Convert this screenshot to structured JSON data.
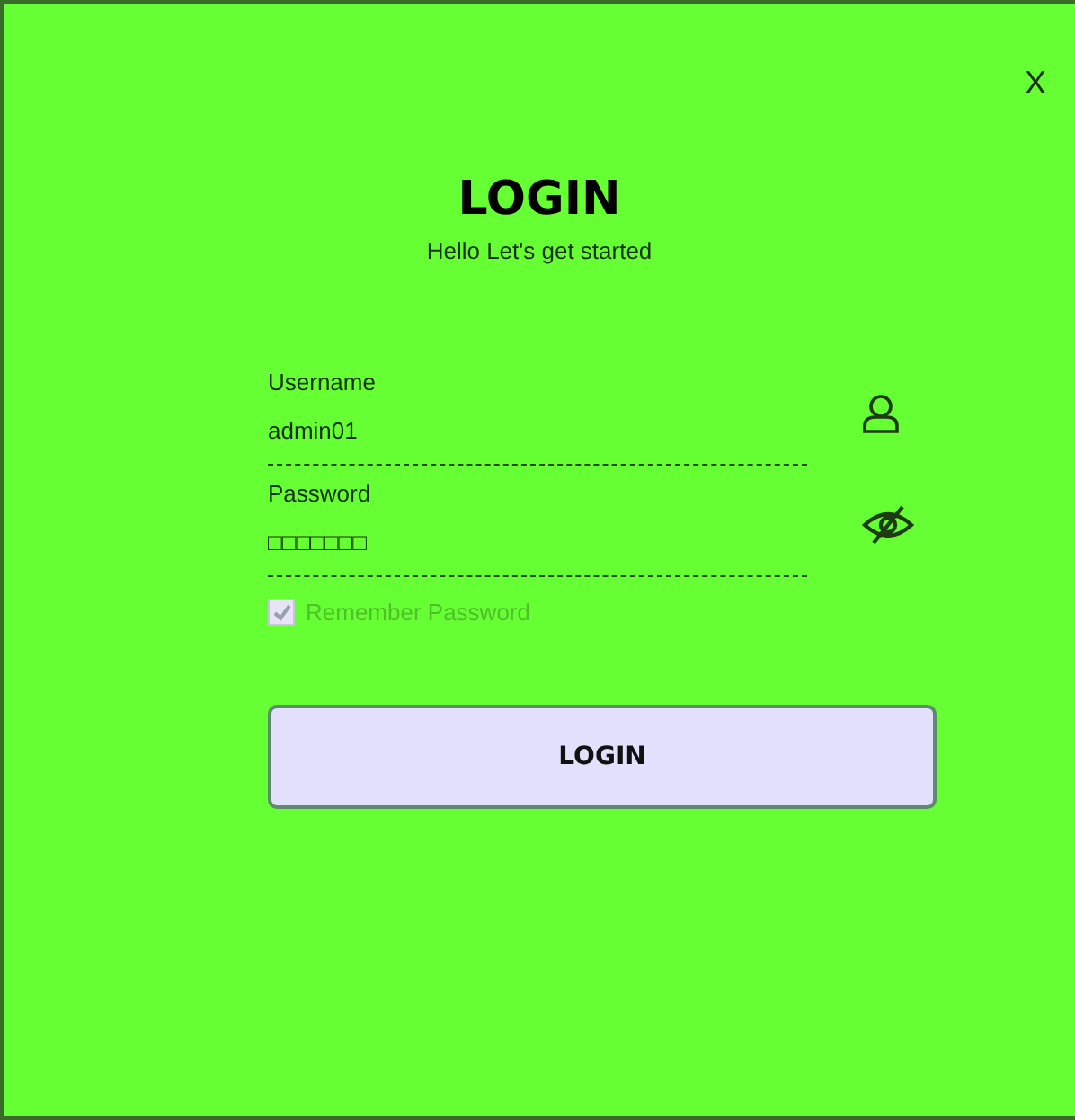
{
  "close_button": "X",
  "title": "LOGIN",
  "subtitle": "Hello Let's get started",
  "fields": [
    {
      "kind": "user",
      "label": "Username",
      "value": "admin01"
    },
    {
      "kind": "password",
      "label": "Password",
      "value": "□□□□□□□"
    }
  ],
  "remember": {
    "label": "Remember Password",
    "checked": true,
    "disabled": true
  },
  "button": "LOGIN"
}
